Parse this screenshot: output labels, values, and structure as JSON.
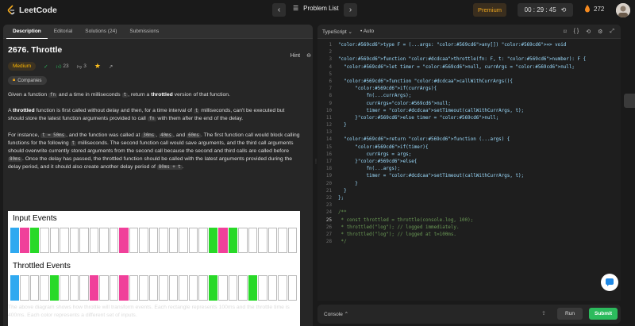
{
  "header": {
    "logo_text": "LeetCode",
    "problem_list_label": "Problem List",
    "premium_label": "Premium",
    "timer": "00 : 29 : 45",
    "streak": "272"
  },
  "left_tabs": [
    "Description",
    "Editorial",
    "Solutions (24)",
    "Submissions"
  ],
  "problem": {
    "title": "2676. Throttle",
    "hint_label": "Hint",
    "difficulty": "Medium",
    "likes": "23",
    "dislikes": "3",
    "companies_label": "Companies"
  },
  "description": {
    "p1_a": "Given a function ",
    "p1_code1": "fn",
    "p1_b": " and a time in milliseconds ",
    "p1_code2": "t",
    "p1_c": ", return a ",
    "p1_bold": "throttled",
    "p1_d": " version of that function.",
    "p2_bold": "throttled",
    "p2_a": "A ",
    "p2_b": " function is first called without delay and then, for a time interval of ",
    "p2_code1": "t",
    "p2_c": " milliseconds, can't be executed but should store the latest function arguments provided to call ",
    "p2_code2": "fn",
    "p2_d": " with them after the end of the delay.",
    "p3_a": "For instance, ",
    "p3_code1": "t = 50ms",
    "p3_b": ", and the function was called at ",
    "p3_code2": "30ms",
    "p3_c": ", ",
    "p3_code3": "40ms",
    "p3_d": ", and ",
    "p3_code4": "60ms",
    "p3_e": ". The first function call would block calling functions for the following ",
    "p3_code5": "t",
    "p3_f": " milliseconds. The second function call would save arguments, and the third call arguments should overwrite currently stored arguments from the second call because the second and third calls are called before ",
    "p3_code6": "80ms",
    "p3_g": ". Once the delay has passed, the throttled function should be called with the latest arguments provided during the delay period, and it should also create another delay period of ",
    "p3_code7": "80ms + t",
    "p3_h": "."
  },
  "diagram": {
    "input_title": "Input Events",
    "throttled_title": "Throttled Events",
    "input_cells": [
      "#2fa9f0",
      "#f0409a",
      "#28d928",
      "",
      "",
      "",
      "",
      "",
      "",
      "",
      "",
      "#f0409a",
      "",
      "",
      "",
      "",
      "",
      "",
      "",
      "",
      "#28d928",
      "#f0409a",
      "#28d928",
      "",
      "",
      "",
      "",
      "",
      ""
    ],
    "throttled_cells": [
      "#2fa9f0",
      "",
      "",
      "",
      "#28d928",
      "",
      "",
      "",
      "#f0409a",
      "",
      "",
      "#f0409a",
      "",
      "",
      "",
      "",
      "",
      "",
      "",
      "",
      "#28d928",
      "",
      "",
      "",
      "#28d928",
      "",
      "",
      "",
      ""
    ]
  },
  "below_text": "The above diagram shows how throttle will transform events. Each rectangle represents 100ms and the throttle time is 400ms. Each color represents a different set of inputs.",
  "editor": {
    "language": "TypeScript",
    "auto_label": "Auto",
    "lines": [
      "type F = (...args: any[]) => void",
      "",
      "function throttle(fn: F, t: number): F {",
      "  let timer = null, currArgs = null;",
      "",
      "  function callWithCurrArgs(){",
      "      if(currArgs){",
      "          fn(...currArgs);",
      "          currArgs=null;",
      "          timer = setTimeout(callWithCurrArgs, t);",
      "      }else timer = null;",
      "  }",
      "",
      "  return function (...args) {",
      "      if(timer){",
      "          currArgs = args;",
      "      }else{",
      "          fn(...args);",
      "          timer = setTimeout(callWithCurrArgs, t);",
      "      }",
      "  }",
      "};",
      "",
      "/**",
      " * const throttled = throttle(console.log, 100);",
      " * throttled(\"log\"); // logged immediately.",
      " * throttled(\"log\"); // logged at t=100ms.",
      " */"
    ],
    "current_line": 25
  },
  "console": {
    "label": "Console",
    "run_label": "Run",
    "submit_label": "Submit"
  }
}
